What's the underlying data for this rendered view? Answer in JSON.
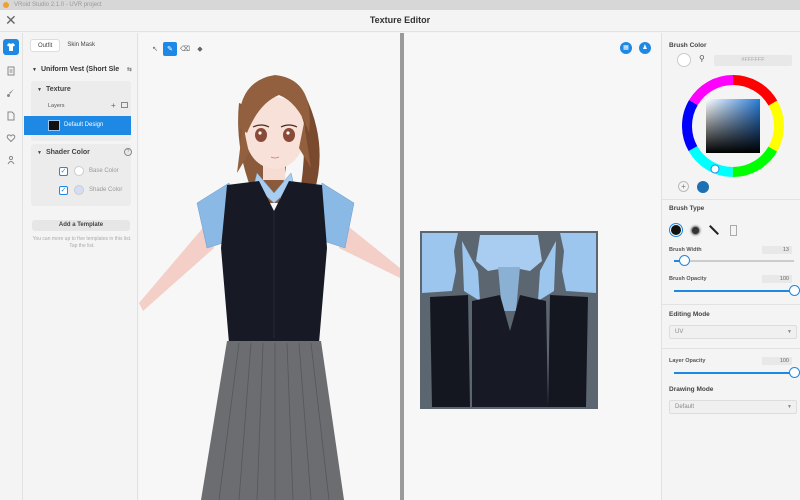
{
  "window": {
    "os_title": "VRoid Studio 2.1.0 - UVR project",
    "title": "Texture Editor"
  },
  "rail": {
    "items": [
      {
        "icon": "shirt-icon",
        "active": true
      },
      {
        "icon": "document-icon",
        "active": false
      },
      {
        "icon": "brush-icon",
        "active": false
      },
      {
        "icon": "file-icon",
        "active": false
      },
      {
        "icon": "heart-icon",
        "active": false
      },
      {
        "icon": "person-icon",
        "active": false
      }
    ]
  },
  "left_panel": {
    "tabs": [
      "Outfit",
      "Skin Mask"
    ],
    "active_tab": "Outfit",
    "outfit_name": "Uniform Vest (Short Sle",
    "texture": {
      "header": "Texture",
      "layers_label": "Layers",
      "selected_layer": "Default Design"
    },
    "shader": {
      "header": "Shader Color",
      "rows": [
        {
          "label": "Base Color",
          "checked": true,
          "color": "#ffffff"
        },
        {
          "label": "Shade Color",
          "checked": true,
          "color": "#d7dcf5"
        }
      ]
    },
    "template_button": "Add a Template",
    "template_note": "You can more up to five templates in this list. Tap the list."
  },
  "toolbar": {
    "tools": [
      {
        "icon": "select-arrow-icon",
        "active": false
      },
      {
        "icon": "pen-icon",
        "active": true
      },
      {
        "icon": "eraser-icon",
        "active": false
      },
      {
        "icon": "fill-icon",
        "active": false
      }
    ]
  },
  "uv_view": {
    "buttons": [
      {
        "icon": "grid-icon"
      },
      {
        "icon": "person-pose-icon"
      }
    ]
  },
  "right_panel": {
    "brush_color": {
      "header": "Brush Color",
      "hex": "#FFFFFF",
      "current_color": "#ffffff",
      "saved_swatch": "#1e6fb4"
    },
    "brush_type": {
      "header": "Brush Type"
    },
    "brush_width": {
      "label": "Brush Width",
      "value": "13",
      "fraction": 0.09
    },
    "brush_opacity": {
      "label": "Brush Opacity",
      "value": "100",
      "fraction": 1.0
    },
    "editing_mode": {
      "header": "Editing Mode",
      "value": "UV"
    },
    "layer_opacity": {
      "label": "Layer Opacity",
      "value": "100",
      "fraction": 1.0
    },
    "drawing_mode": {
      "header": "Drawing Mode",
      "value": "Default"
    }
  }
}
